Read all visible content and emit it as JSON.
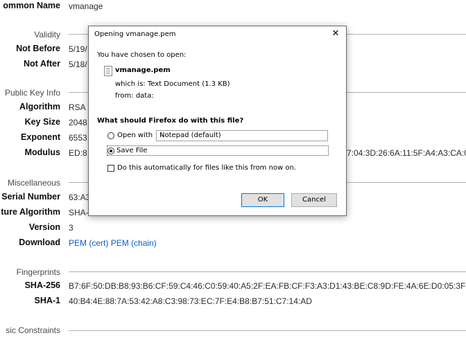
{
  "page": {
    "common_name_label": "ommon Name",
    "common_name_value": "vmanage",
    "validity_section": "Validity",
    "not_before_label": "Not Before",
    "not_before_value": "5/19/",
    "not_after_label": "Not After",
    "not_after_value": "5/18/",
    "public_key_section": "Public Key Info",
    "algorithm_label": "Algorithm",
    "algorithm_value": "RSA",
    "key_size_label": "Key Size",
    "key_size_value": "2048",
    "exponent_label": "Exponent",
    "exponent_value": "6553",
    "modulus_label": "Modulus",
    "modulus_value_left": "ED:8",
    "modulus_value_right": "7:04:3D:26:6A:11:5F:A4:A3:CA:0",
    "misc_section": "Miscellaneous",
    "serial_label": "Serial Number",
    "serial_value": "63:A3",
    "sig_algo_label": "ture Algorithm",
    "sig_algo_value": "SHA-",
    "version_label": "Version",
    "version_value": "3",
    "download_label": "Download",
    "download_link_cert": "PEM (cert)",
    "download_link_chain": "PEM (chain)",
    "fingerprints_section": "Fingerprints",
    "sha256_label": "SHA-256",
    "sha256_value": "B7:6F:50:DB:B8:93:B6:CF:59:C4:46:C0:59:40:A5:2F:EA:FB:CF:F3:A3:D1:43:BE:C8:9D:FE:4A:6E:D0:05:3F",
    "sha1_label": "SHA-1",
    "sha1_value": "40:B4:4E:88:7A:53:42:A8:C3:98:73:EC:7F:E4:B8:B7:51:C7:14:AD",
    "basic_constraints_section": "sic Constraints"
  },
  "dialog": {
    "title": "Opening vmanage.pem",
    "close_glyph": "✕",
    "intro": "You have chosen to open:",
    "file_name": "vmanage.pem",
    "which_is": "which is:  Text Document (1.3 KB)",
    "from": "from:  data:",
    "question": "What should Firefox do with this file?",
    "open_with_label": "Open with",
    "open_with_value": "Notepad (default)",
    "save_file_label": "Save File",
    "auto_label": "Do this automatically for files like this from now on.",
    "ok_label": "OK",
    "cancel_label": "Cancel",
    "selected_option": "save_file",
    "auto_checked": false
  }
}
